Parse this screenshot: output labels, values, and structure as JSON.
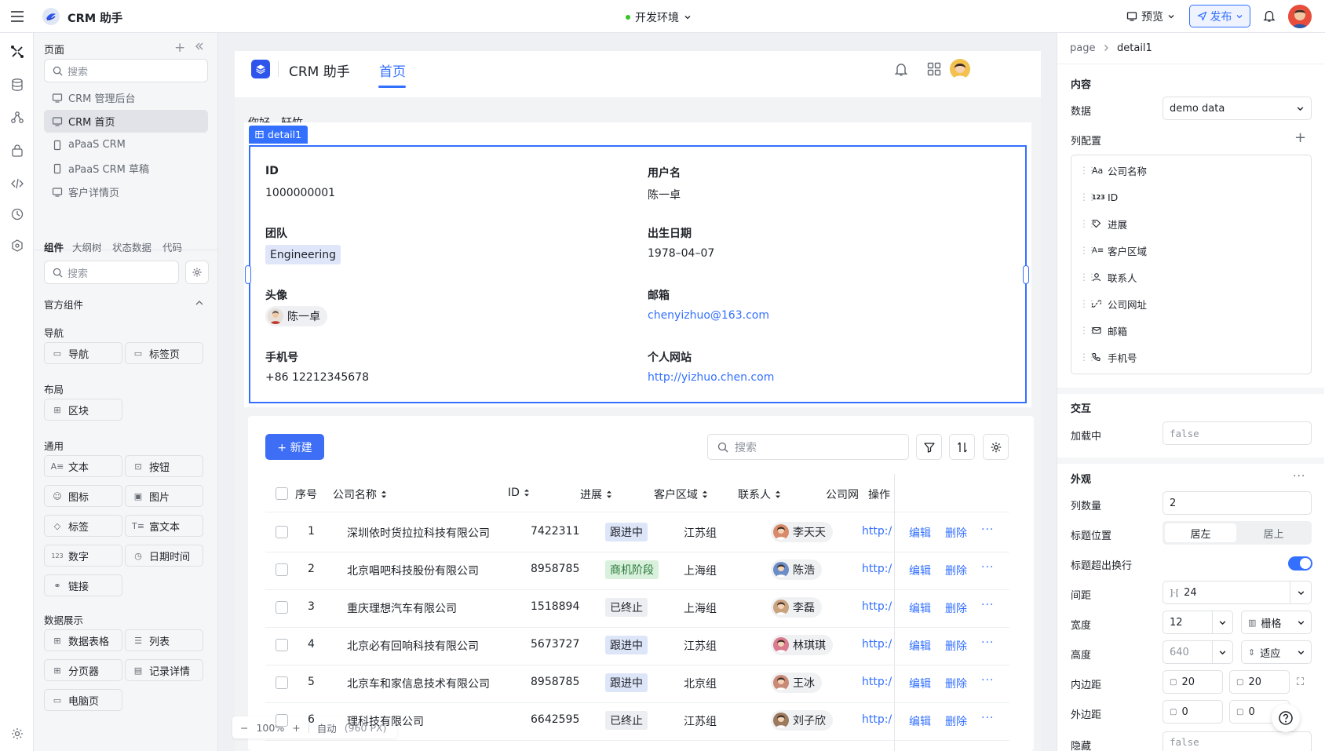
{
  "topbar": {
    "app_name": "CRM 助手",
    "env": "开发环境",
    "preview": "预览",
    "publish": "发布"
  },
  "sidebar": {
    "pages_title": "页面",
    "search_placeholder": "搜索",
    "pages": [
      {
        "label": "CRM 管理后台",
        "icon": "desktop"
      },
      {
        "label": "CRM 首页",
        "icon": "desktop",
        "active": true
      },
      {
        "label": "aPaaS CRM",
        "icon": "mobile"
      },
      {
        "label": "aPaaS CRM 草稿",
        "icon": "mobile"
      },
      {
        "label": "客户详情页",
        "icon": "desktop"
      }
    ],
    "tabs": [
      "组件",
      "大纲树",
      "状态数据",
      "代码"
    ],
    "comp_search_placeholder": "搜索",
    "official": "官方组件",
    "groups": {
      "nav": "导航",
      "layout": "布局",
      "common": "通用",
      "data": "数据展示"
    },
    "components": {
      "nav": [
        "导航",
        "标签页"
      ],
      "layout": [
        "区块"
      ],
      "common": [
        "文本",
        "按钮",
        "图标",
        "图片",
        "标签",
        "富文本",
        "数字",
        "日期时间",
        "链接"
      ],
      "data": [
        "数据表格",
        "列表",
        "分页器",
        "记录详情",
        "电脑页"
      ]
    }
  },
  "app": {
    "title": "CRM 助手",
    "nav_tab": "首页",
    "greeting": "你好，轩竹",
    "detail_tag": "detail1",
    "fields": {
      "id_label": "ID",
      "id_value": "1000000001",
      "username_label": "用户名",
      "username_value": "陈一卓",
      "team_label": "团队",
      "team_value": "Engineering",
      "birth_label": "出生日期",
      "birth_value": "1978–04–07",
      "avatar_label": "头像",
      "avatar_value": "陈一卓",
      "email_label": "邮箱",
      "email_value": "chenyizhuo@163.com",
      "phone_label": "手机号",
      "phone_value": "+86 12212345678",
      "site_label": "个人网站",
      "site_value": "http://yizhuo.chen.com"
    }
  },
  "table": {
    "new_button": "+ 新建",
    "search_placeholder": "搜索",
    "headers": [
      "序号",
      "公司名称",
      "ID",
      "进展",
      "客户区域",
      "联系人",
      "公司网",
      "操作"
    ],
    "edit": "编辑",
    "delete": "删除",
    "rows": [
      {
        "no": "1",
        "company": "深圳依时货拉拉科技有限公司",
        "id": "7422311",
        "status": "跟进中",
        "status_kind": "blue",
        "region": "江苏组",
        "contact": "李天天",
        "site": "http:/"
      },
      {
        "no": "2",
        "company": "北京唱吧科技股份有限公司",
        "id": "8958785",
        "status": "商机阶段",
        "status_kind": "green",
        "region": "上海组",
        "contact": "陈浩",
        "site": "http:/"
      },
      {
        "no": "3",
        "company": "重庆理想汽车有限公司",
        "id": "1518894",
        "status": "已终止",
        "status_kind": "gray",
        "region": "上海组",
        "contact": "李磊",
        "site": "http:/"
      },
      {
        "no": "4",
        "company": "北京必有回响科技有限公司",
        "id": "5673727",
        "status": "跟进中",
        "status_kind": "blue",
        "region": "江苏组",
        "contact": "林琪琪",
        "site": "http:/"
      },
      {
        "no": "5",
        "company": "北京车和家信息技术有限公司",
        "id": "8958785",
        "status": "跟进中",
        "status_kind": "blue",
        "region": "北京组",
        "contact": "王冰",
        "site": "http:/"
      },
      {
        "no": "6",
        "company": "理科技有限公司",
        "id": "6642595",
        "status": "已终止",
        "status_kind": "gray",
        "region": "江苏组",
        "contact": "刘子欣",
        "site": "http:/"
      }
    ]
  },
  "zoom": {
    "value": "100%",
    "mode": "自动",
    "width": "(960 PX)"
  },
  "panel": {
    "breadcrumb_root": "page",
    "breadcrumb_current": "detail1",
    "content_title": "内容",
    "data_label": "数据",
    "data_value": "demo data",
    "columns_label": "列配置",
    "columns": [
      {
        "icon": "Aa",
        "label": "公司名称"
      },
      {
        "icon": "123",
        "label": "ID"
      },
      {
        "icon": "tag",
        "label": "进展"
      },
      {
        "icon": "A≡",
        "label": "客户区域"
      },
      {
        "icon": "user",
        "label": "联系人"
      },
      {
        "icon": "link",
        "label": "公司网址"
      },
      {
        "icon": "mail",
        "label": "邮箱"
      },
      {
        "icon": "phone",
        "label": "手机号"
      }
    ],
    "interaction_title": "交互",
    "loading_label": "加载中",
    "loading_value": "false",
    "appearance_title": "外观",
    "col_count_label": "列数量",
    "col_count_value": "2",
    "title_pos_label": "标题位置",
    "title_pos_left": "居左",
    "title_pos_top": "居上",
    "wrap_label": "标题超出换行",
    "wrap_on": true,
    "gap_label": "间距",
    "gap_value": "24",
    "width_label": "宽度",
    "width_value": "12",
    "width_unit": "栅格",
    "height_label": "高度",
    "height_value": "640",
    "height_unit": "适应",
    "padding_label": "内边距",
    "padding_a": "20",
    "padding_b": "20",
    "margin_label": "外边距",
    "margin_a": "0",
    "margin_b": "0",
    "hidden_label": "隐藏",
    "hidden_value": "false"
  },
  "colors": {
    "accent": "#3370ff",
    "brand": "#2f54eb"
  }
}
